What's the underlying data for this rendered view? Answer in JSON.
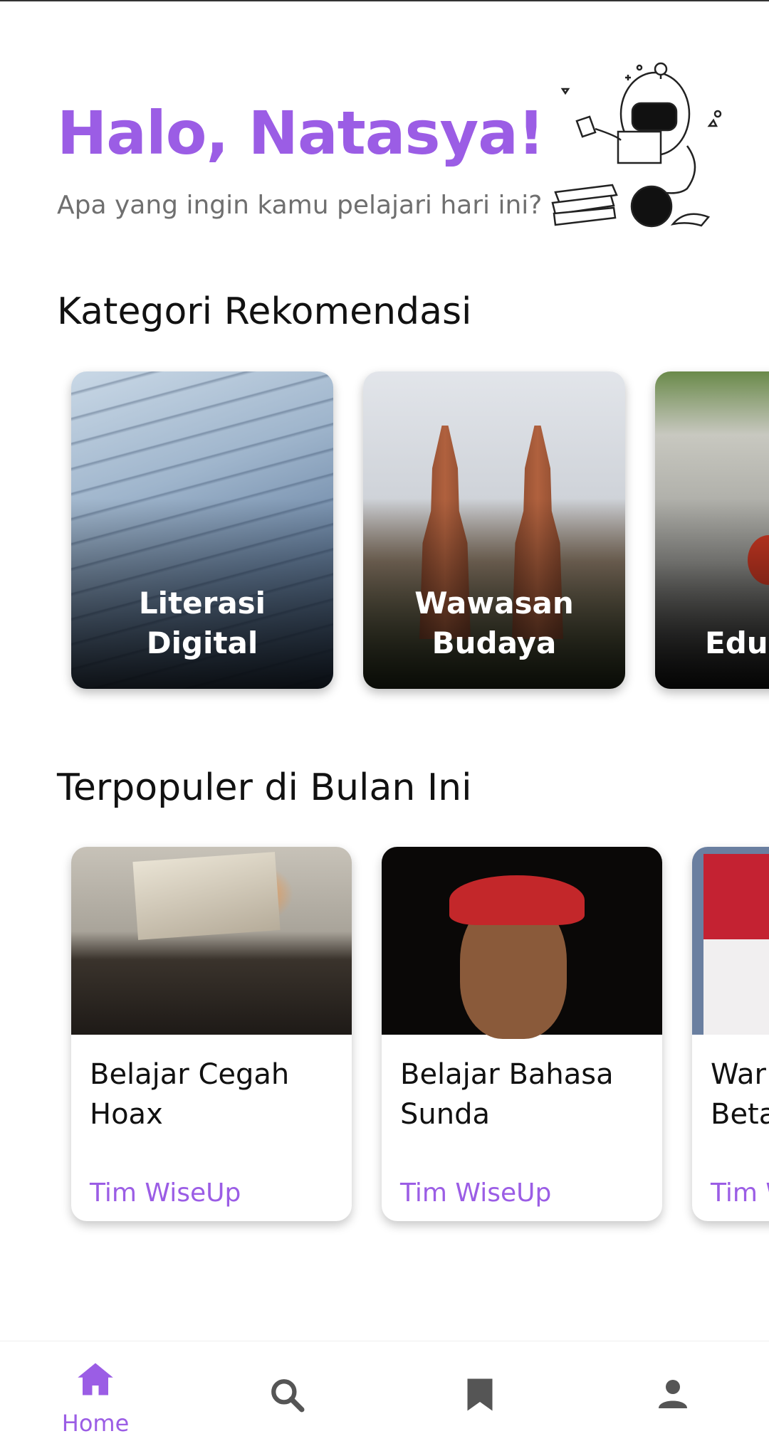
{
  "header": {
    "greeting": "Halo, Natasya!",
    "subtitle": "Apa yang ingin kamu pelajari hari ini?",
    "illustration_icon": "robot-reading-icon"
  },
  "sections": {
    "categories_title": "Kategori Rekomendasi",
    "popular_title": "Terpopuler di Bulan Ini"
  },
  "categories": [
    {
      "label": "Literasi Digital"
    },
    {
      "label": "Wawasan Budaya"
    },
    {
      "label": "Eduka"
    }
  ],
  "popular": [
    {
      "title": "Belajar Cegah Hoax",
      "author": "Tim WiseUp"
    },
    {
      "title": "Belajar Bahasa Sunda",
      "author": "Tim WiseUp"
    },
    {
      "title": "War Beta",
      "author": "Tim W"
    }
  ],
  "bottom_nav": {
    "items": [
      {
        "icon": "home-icon",
        "label": "Home",
        "active": true
      },
      {
        "icon": "search-icon",
        "label": ""
      },
      {
        "icon": "bookmark-icon",
        "label": ""
      },
      {
        "icon": "profile-icon",
        "label": ""
      }
    ]
  },
  "colors": {
    "accent": "#9b5de5",
    "icon_inactive": "#555555"
  }
}
